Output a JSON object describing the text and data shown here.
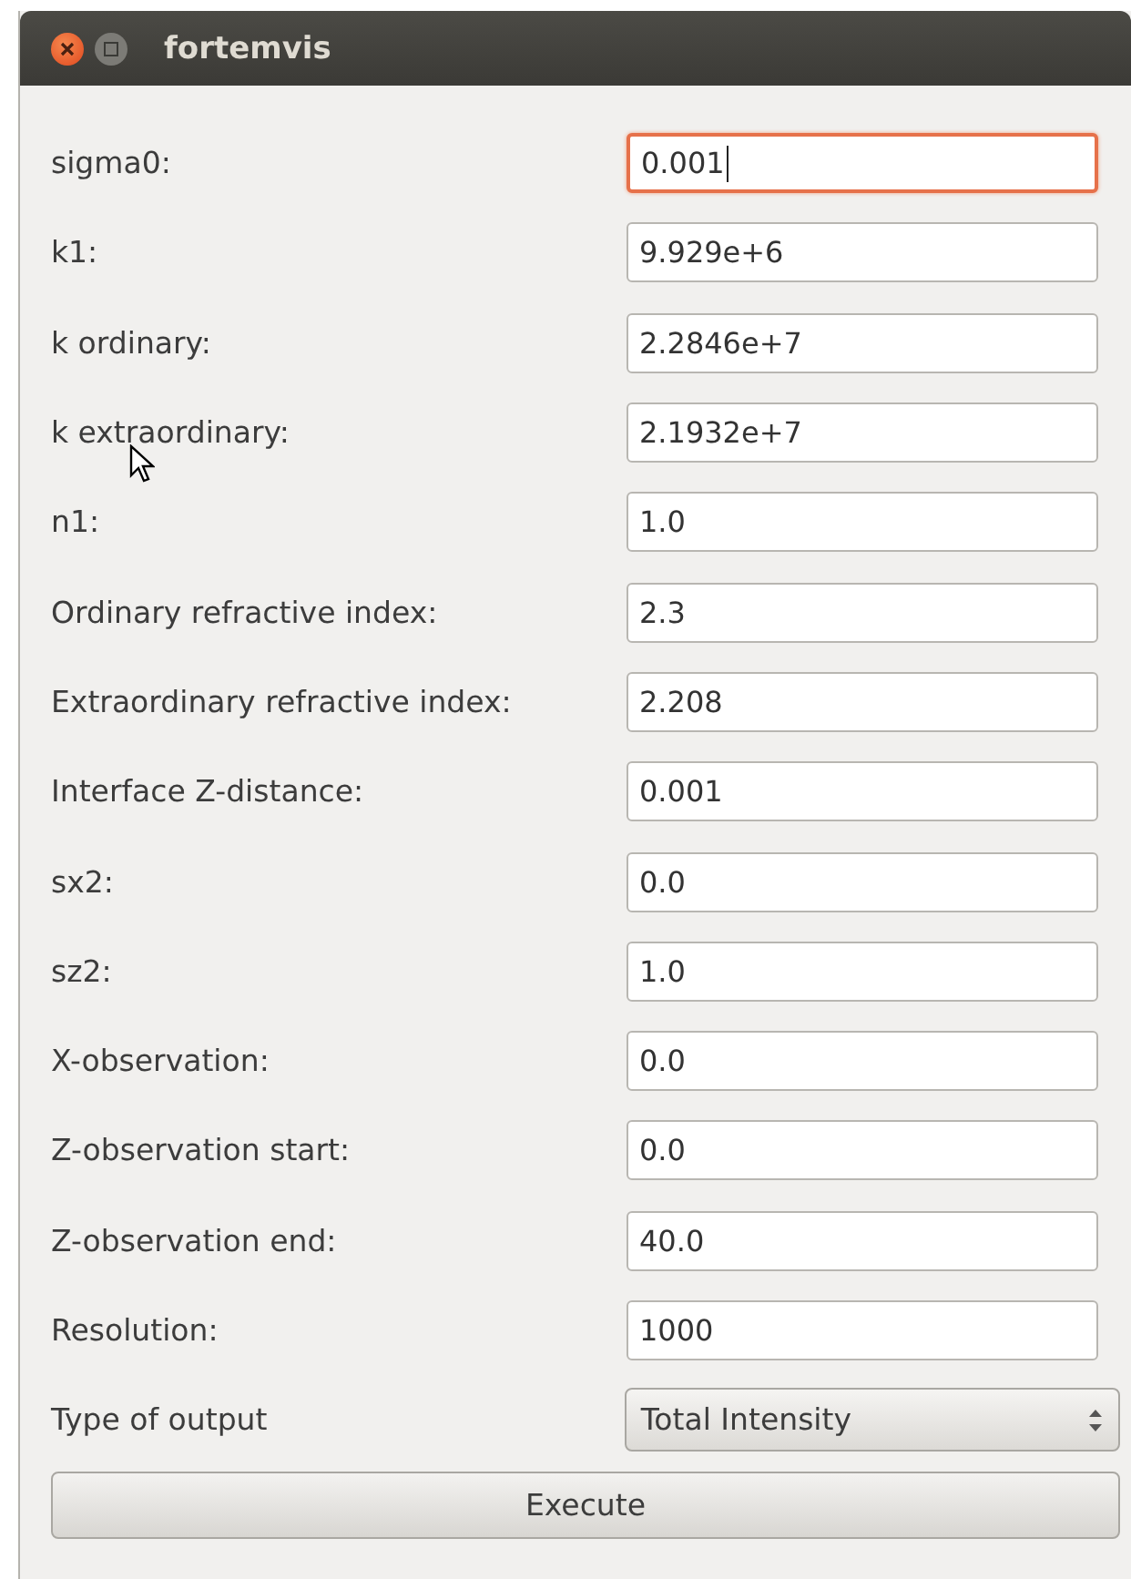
{
  "window": {
    "title": "fortemvis"
  },
  "fields": [
    {
      "kind": "text",
      "label": "sigma0:",
      "value": "0.001",
      "focused": true
    },
    {
      "kind": "text",
      "label": "k1:",
      "value": "9.929e+6",
      "focused": false
    },
    {
      "kind": "text",
      "label": "k ordinary:",
      "value": "2.2846e+7",
      "focused": false
    },
    {
      "kind": "text",
      "label": "k extraordinary:",
      "value": "2.1932e+7",
      "focused": false
    },
    {
      "kind": "text",
      "label": "n1:",
      "value": "1.0",
      "focused": false
    },
    {
      "kind": "text",
      "label": "Ordinary refractive index:",
      "value": "2.3",
      "focused": false
    },
    {
      "kind": "text",
      "label": "Extraordinary refractive index:",
      "value": "2.208",
      "focused": false
    },
    {
      "kind": "text",
      "label": "Interface Z-distance:",
      "value": "0.001",
      "focused": false
    },
    {
      "kind": "text",
      "label": "sx2:",
      "value": "0.0",
      "focused": false
    },
    {
      "kind": "text",
      "label": "sz2:",
      "value": "1.0",
      "focused": false
    },
    {
      "kind": "text",
      "label": "X-observation:",
      "value": "0.0",
      "focused": false
    },
    {
      "kind": "text",
      "label": "Z-observation start:",
      "value": "0.0",
      "focused": false
    },
    {
      "kind": "text",
      "label": "Z-observation end:",
      "value": "40.0",
      "focused": false
    },
    {
      "kind": "text",
      "label": "Resolution:",
      "value": "1000",
      "focused": false
    },
    {
      "kind": "select",
      "label": "Type of output",
      "value": "Total Intensity"
    }
  ],
  "buttons": [
    "Execute"
  ]
}
